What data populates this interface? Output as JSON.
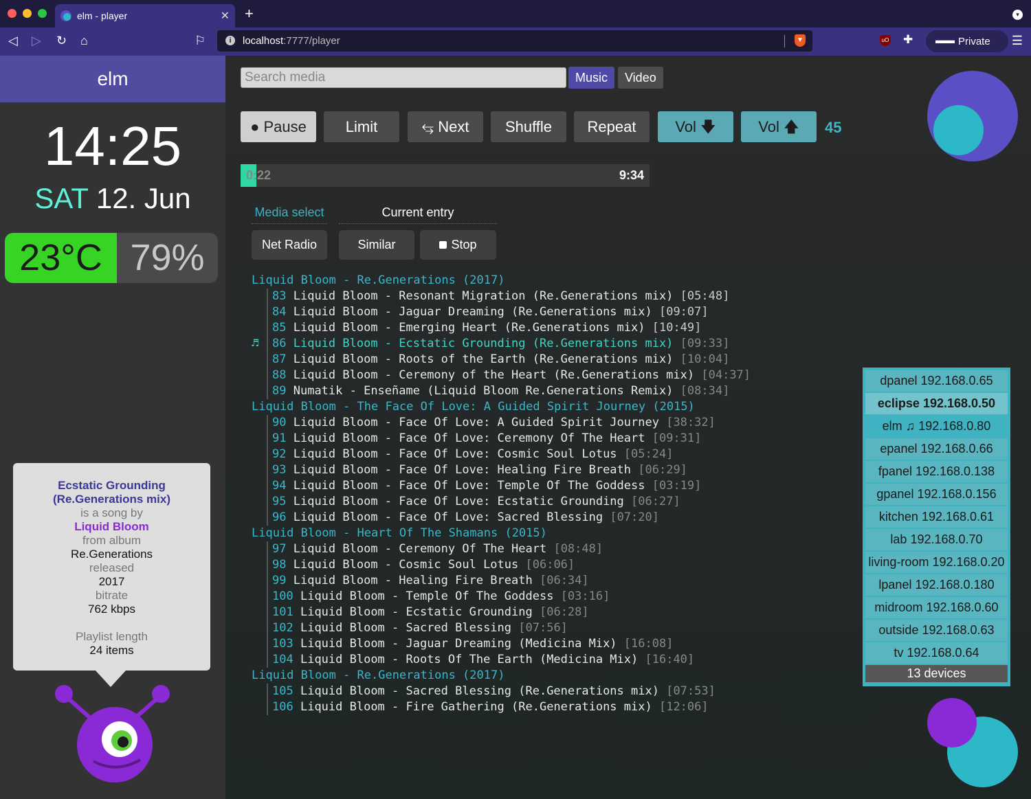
{
  "browser": {
    "tab_title": "elm - player",
    "tab_close": "✕",
    "new_tab": "+",
    "url_host": "localhost",
    "url_path": ":7777/player",
    "private_label": "Private"
  },
  "sidebar": {
    "brand": "elm",
    "time": "14:25",
    "day": "SAT",
    "date": "12. Jun",
    "temperature": "23°C",
    "humidity": "79%"
  },
  "info": {
    "title": "Ecstatic Grounding (Re.Generations mix)",
    "is_song_by": "is a song by",
    "artist": "Liquid Bloom",
    "from_album_label": "from album",
    "album": "Re.Generations",
    "released_label": "released",
    "released": "2017",
    "bitrate_label": "bitrate",
    "bitrate": "762 kbps",
    "playlist_length_label": "Playlist length",
    "playlist_length": "24 items"
  },
  "search": {
    "placeholder": "Search media"
  },
  "modes": {
    "music": "Music",
    "video": "Video"
  },
  "controls": {
    "pause": "● Pause",
    "limit": "Limit",
    "next": "⥃ Next",
    "shuffle": "Shuffle",
    "repeat": "Repeat",
    "vol_down": "Vol 🡇",
    "vol_up": "Vol 🡅",
    "volume": "45"
  },
  "progress": {
    "current": "0:22",
    "total": "9:34",
    "fraction": 0.038
  },
  "sections": {
    "media_select": "Media select",
    "current_entry": "Current entry",
    "net_radio": "Net Radio",
    "similar": "Similar",
    "stop": "Stop"
  },
  "playlist": [
    {
      "album": "Liquid Bloom - Re.Generations (2017)",
      "tracks": [
        {
          "num": "83",
          "title": "Liquid Bloom - Resonant Migration (Re.Generations mix)",
          "dur": "[05:48]",
          "durColor": "#ccc"
        },
        {
          "num": "84",
          "title": "Liquid Bloom - Jaguar Dreaming (Re.Generations mix)",
          "dur": "[09:07]",
          "durColor": "#ccc"
        },
        {
          "num": "85",
          "title": "Liquid Bloom - Emerging Heart (Re.Generations mix)",
          "dur": "[10:49]",
          "durColor": "#ccc"
        },
        {
          "num": "86",
          "title": "Liquid Bloom - Ecstatic Grounding (Re.Generations mix)",
          "dur": "[09:33]",
          "current": true
        },
        {
          "num": "87",
          "title": "Liquid Bloom - Roots of the Earth (Re.Generations mix)",
          "dur": "[10:04]"
        },
        {
          "num": "88",
          "title": "Liquid Bloom - Ceremony of the Heart (Re.Generations mix)",
          "dur": "[04:37]"
        },
        {
          "num": "89",
          "title": "Numatik - Enseñame (Liquid Bloom Re.Generations Remix)",
          "dur": "[08:34]"
        }
      ]
    },
    {
      "album": "Liquid Bloom - The Face Of Love: A Guided Spirit Journey (2015)",
      "tracks": [
        {
          "num": "90",
          "title": "Liquid Bloom - Face Of Love: A Guided Spirit Journey",
          "dur": "[38:32]"
        },
        {
          "num": "91",
          "title": "Liquid Bloom - Face Of Love: Ceremony Of The Heart",
          "dur": "[09:31]"
        },
        {
          "num": "92",
          "title": "Liquid Bloom - Face Of Love: Cosmic Soul Lotus",
          "dur": "[05:24]"
        },
        {
          "num": "93",
          "title": "Liquid Bloom - Face Of Love: Healing Fire Breath",
          "dur": "[06:29]"
        },
        {
          "num": "94",
          "title": "Liquid Bloom - Face Of Love: Temple Of The Goddess",
          "dur": "[03:19]"
        },
        {
          "num": "95",
          "title": "Liquid Bloom - Face Of Love: Ecstatic Grounding",
          "dur": "[06:27]"
        },
        {
          "num": "96",
          "title": "Liquid Bloom - Face Of Love: Sacred Blessing",
          "dur": "[07:20]"
        }
      ]
    },
    {
      "album": "Liquid Bloom - Heart Of The Shamans (2015)",
      "tracks": [
        {
          "num": "97",
          "title": "Liquid Bloom - Ceremony Of The Heart",
          "dur": "[08:48]"
        },
        {
          "num": "98",
          "title": "Liquid Bloom - Cosmic Soul Lotus",
          "dur": "[06:06]"
        },
        {
          "num": "99",
          "title": "Liquid Bloom - Healing Fire Breath",
          "dur": "[06:34]"
        },
        {
          "num": "100",
          "title": "Liquid Bloom - Temple Of The Goddess",
          "dur": "[03:16]"
        },
        {
          "num": "101",
          "title": "Liquid Bloom - Ecstatic Grounding",
          "dur": "[06:28]"
        },
        {
          "num": "102",
          "title": "Liquid Bloom - Sacred Blessing",
          "dur": "[07:56]"
        },
        {
          "num": "103",
          "title": "Liquid Bloom - Jaguar Dreaming (Medicina Mix)",
          "dur": "[16:08]"
        },
        {
          "num": "104",
          "title": "Liquid Bloom - Roots Of The Earth (Medicina Mix)",
          "dur": "[16:40]"
        }
      ]
    },
    {
      "album": "Liquid Bloom - Re.Generations (2017)",
      "tracks": [
        {
          "num": "105",
          "title": "Liquid Bloom - Sacred Blessing (Re.Generations mix)",
          "dur": "[07:53]"
        },
        {
          "num": "106",
          "title": "Liquid Bloom - Fire Gathering (Re.Generations mix)",
          "dur": "[12:06]"
        }
      ]
    }
  ],
  "devices": {
    "items": [
      {
        "name": "dpanel",
        "ip": "192.168.0.65"
      },
      {
        "name": "eclipse",
        "ip": "192.168.0.50",
        "selected": true
      },
      {
        "name": "elm ♫",
        "ip": "192.168.0.80",
        "current": true
      },
      {
        "name": "epanel",
        "ip": "192.168.0.66"
      },
      {
        "name": "fpanel",
        "ip": "192.168.0.138"
      },
      {
        "name": "gpanel",
        "ip": "192.168.0.156"
      },
      {
        "name": "kitchen",
        "ip": "192.168.0.61"
      },
      {
        "name": "lab",
        "ip": "192.168.0.70"
      },
      {
        "name": "living-room",
        "ip": "192.168.0.20"
      },
      {
        "name": "lpanel",
        "ip": "192.168.0.180"
      },
      {
        "name": "midroom",
        "ip": "192.168.0.60"
      },
      {
        "name": "outside",
        "ip": "192.168.0.63"
      },
      {
        "name": "tv",
        "ip": "192.168.0.64"
      }
    ],
    "count": "13 devices"
  },
  "colors": {
    "accent": "#3ab7c8",
    "brand": "#514c9f",
    "temperature_bg": "#37d325",
    "current_track": "#3fd6c5"
  }
}
